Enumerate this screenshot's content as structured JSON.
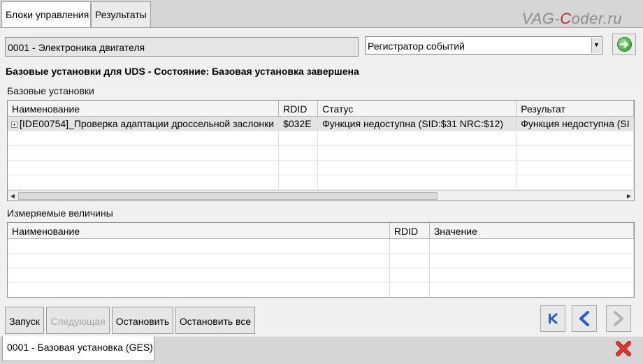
{
  "tabs": [
    {
      "label": "Блоки управления"
    },
    {
      "label": "Результаты"
    }
  ],
  "watermark": {
    "part1": "VAG-",
    "part2": "C",
    "part3": "oder.ru"
  },
  "ecu": {
    "label": "0001 - Электроника двигателя"
  },
  "mode_select": {
    "value": "Регистратор событий"
  },
  "status_title": "Базовые установки для UDS - Состояние: Базовая установка завершена",
  "basic_settings": {
    "section_label": "Базовые установки",
    "columns": [
      "Наименование",
      "RDID",
      "Статус",
      "Результат"
    ],
    "rows": [
      {
        "name": "[IDE00754]_Проверка адаптации дроссельной заслонки",
        "rdid": "$032E",
        "status": "Функция недоступна (SID:$31 NRC:$12)",
        "result": "Функция недоступна (SI"
      }
    ]
  },
  "measured_values": {
    "section_label": "Измеряемые величины",
    "columns": [
      "Наименование",
      "RDID",
      "Значение"
    ]
  },
  "buttons": {
    "start": "Запуск",
    "next": "Следующая",
    "stop": "Остановить",
    "stop_all": "Остановить все"
  },
  "bottom_tab": {
    "label": "0001 - Базовая установка (GES)"
  },
  "icons": {
    "go": "arrow-right-circle-icon",
    "first": "skip-first-icon",
    "back": "chevron-left-icon",
    "forward": "chevron-right-icon",
    "close": "close-x-icon"
  },
  "colors": {
    "accent_blue": "#1f5fd6",
    "go_green": "#2b9b2b",
    "close_red": "#d8261c"
  }
}
